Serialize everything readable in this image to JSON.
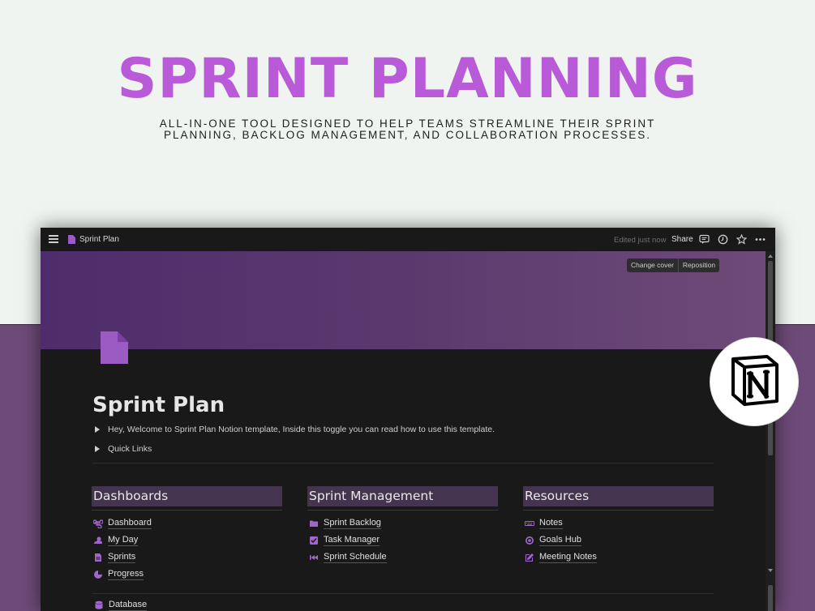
{
  "hero": {
    "title": "SPRINT PLANNING",
    "subtitle_line1": "ALL-IN-ONE TOOL DESIGNED TO HELP TEAMS STREAMLINE THEIR SPRINT",
    "subtitle_line2": "PLANNING, BACKLOG MANAGEMENT, AND COLLABORATION PROCESSES."
  },
  "topbar": {
    "breadcrumb": "Sprint Plan",
    "edited": "Edited just now",
    "share": "Share"
  },
  "cover": {
    "change_cover": "Change cover",
    "reposition": "Reposition"
  },
  "page": {
    "title": "Sprint Plan",
    "toggles": [
      "Hey, Welcome to Sprint Plan Notion template, Inside this toggle you can read how to use this template.",
      "Quick Links"
    ]
  },
  "columns": [
    {
      "header": "Dashboards",
      "links": [
        {
          "label": "Dashboard",
          "icon": "command-icon"
        },
        {
          "label": "My Day",
          "icon": "sun-cloud-icon"
        },
        {
          "label": "Sprints",
          "icon": "document-icon"
        },
        {
          "label": "Progress",
          "icon": "pie-chart-icon"
        }
      ]
    },
    {
      "header": "Sprint Management",
      "links": [
        {
          "label": "Sprint Backlog",
          "icon": "folder-icon"
        },
        {
          "label": "Task Manager",
          "icon": "checkbox-icon"
        },
        {
          "label": "Sprint Schedule",
          "icon": "rewind-icon"
        }
      ]
    },
    {
      "header": "Resources",
      "links": [
        {
          "label": "Notes",
          "icon": "keyboard-icon"
        },
        {
          "label": "Goals Hub",
          "icon": "target-icon"
        },
        {
          "label": "Meeting Notes",
          "icon": "edit-icon"
        }
      ]
    }
  ],
  "bottom_link": {
    "label": "Database",
    "icon": "database-icon"
  },
  "colors": {
    "accent": "#b95ad8",
    "icon_purple": "#9a5bc2",
    "header_bg": "#45344f",
    "app_bg": "#191919",
    "band": "#6e4a78"
  }
}
